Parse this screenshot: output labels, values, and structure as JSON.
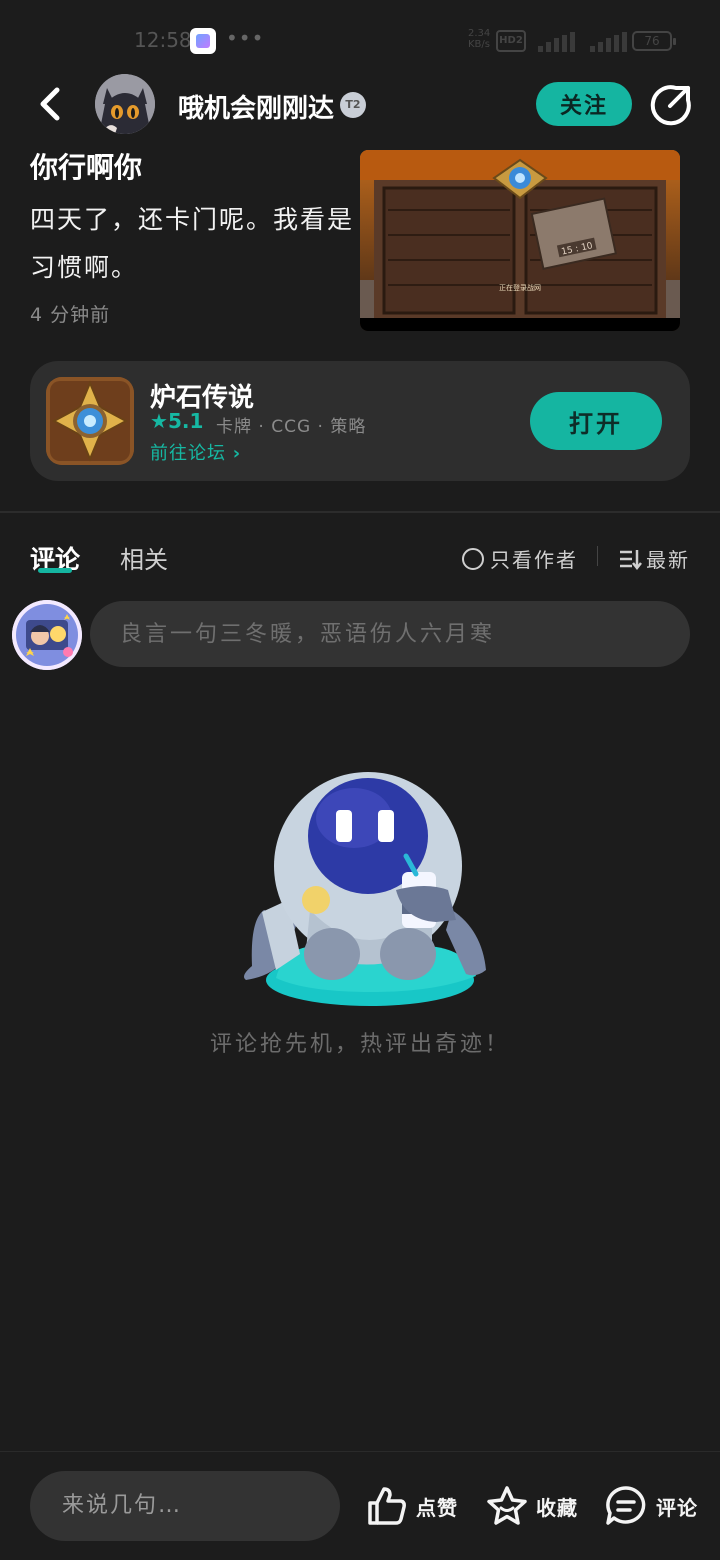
{
  "status_bar": {
    "time": "12:58",
    "dots": "•••",
    "net_speed": "2.34\nKB/s",
    "hd": "HD2",
    "battery": "76"
  },
  "header": {
    "username": "哦机会刚刚达",
    "level_badge": "T2",
    "follow_label": "关注"
  },
  "post": {
    "title": "你行啊你",
    "body": "四天了，还卡门呢。我看是",
    "body_line2": "习惯啊。",
    "time": "4 分钟前",
    "image_caption": "正在登录战网",
    "image_countdown": "15 : 10"
  },
  "game_card": {
    "name": "炉石传说",
    "rating": "5.1",
    "tags": "卡牌 · CCG · 策略",
    "forum_link": "前往论坛",
    "open_label": "打开"
  },
  "tabs": {
    "comment": "评论",
    "related": "相关",
    "author_only": "只看作者",
    "sort": "最新"
  },
  "comment_box": {
    "placeholder": "良言一句三冬暖，恶语伤人六月寒"
  },
  "empty_state": {
    "text": "评论抢先机，热评出奇迹！"
  },
  "bottom_bar": {
    "input_placeholder": "来说几句…",
    "like_label": "点赞",
    "favorite_label": "收藏",
    "comment_label": "评论"
  },
  "colors": {
    "accent": "#15b5a1",
    "background": "#1c1c1c",
    "card": "#2e2e2e"
  }
}
